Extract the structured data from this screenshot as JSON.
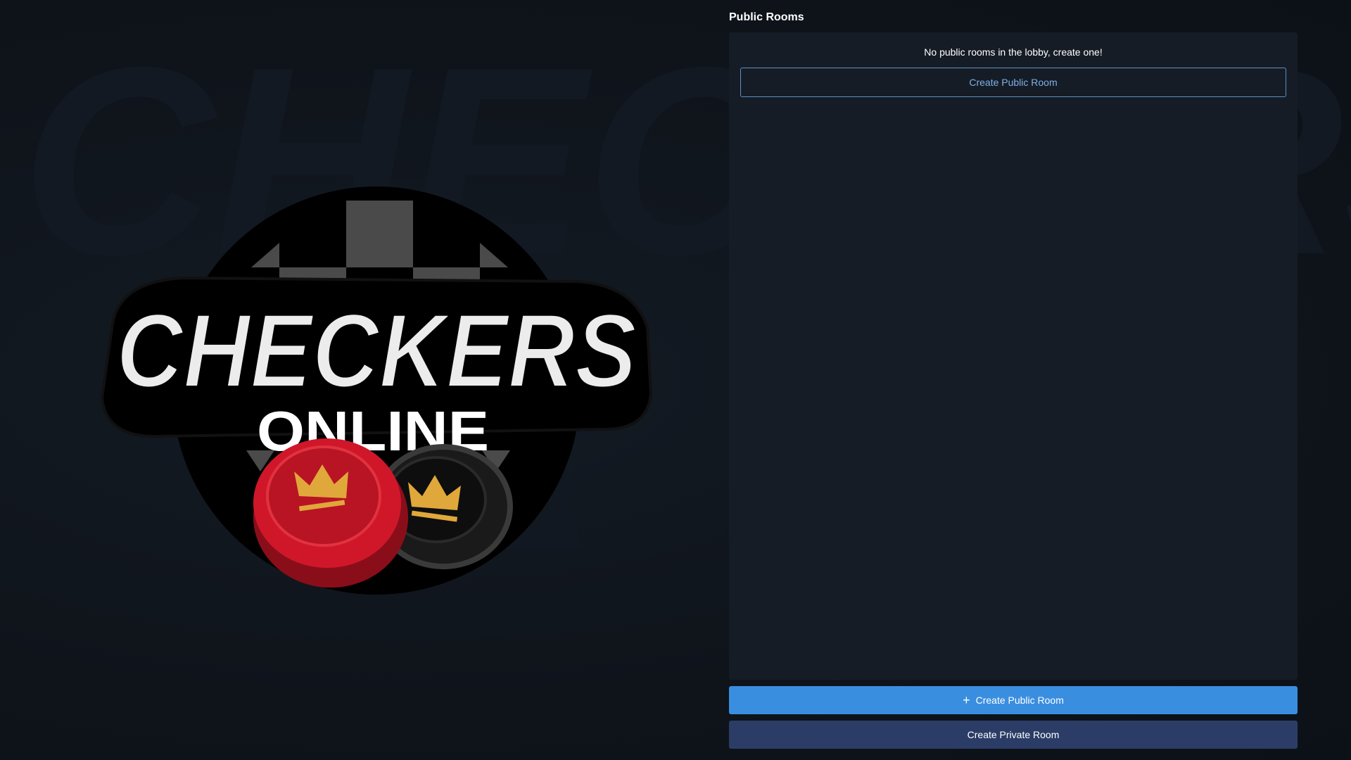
{
  "logo": {
    "title": "CHECKERS",
    "subtitle": "ONLINE",
    "watermark_text": "CHECKERS"
  },
  "lobby": {
    "heading": "Public Rooms",
    "empty_message": "No public rooms in the lobby, create one!",
    "inline_create_label": "Create Public Room"
  },
  "actions": {
    "create_public_label": "Create Public Room",
    "create_public_icon": "plus-icon",
    "create_private_label": "Create Private Room"
  },
  "colors": {
    "background": "#0f141b",
    "panel": "#161c25",
    "accent_blue": "#3a8ee0",
    "private_button": "#2b3d66",
    "checker_red": "#d0172a",
    "crown_gold": "#e0a83a"
  }
}
